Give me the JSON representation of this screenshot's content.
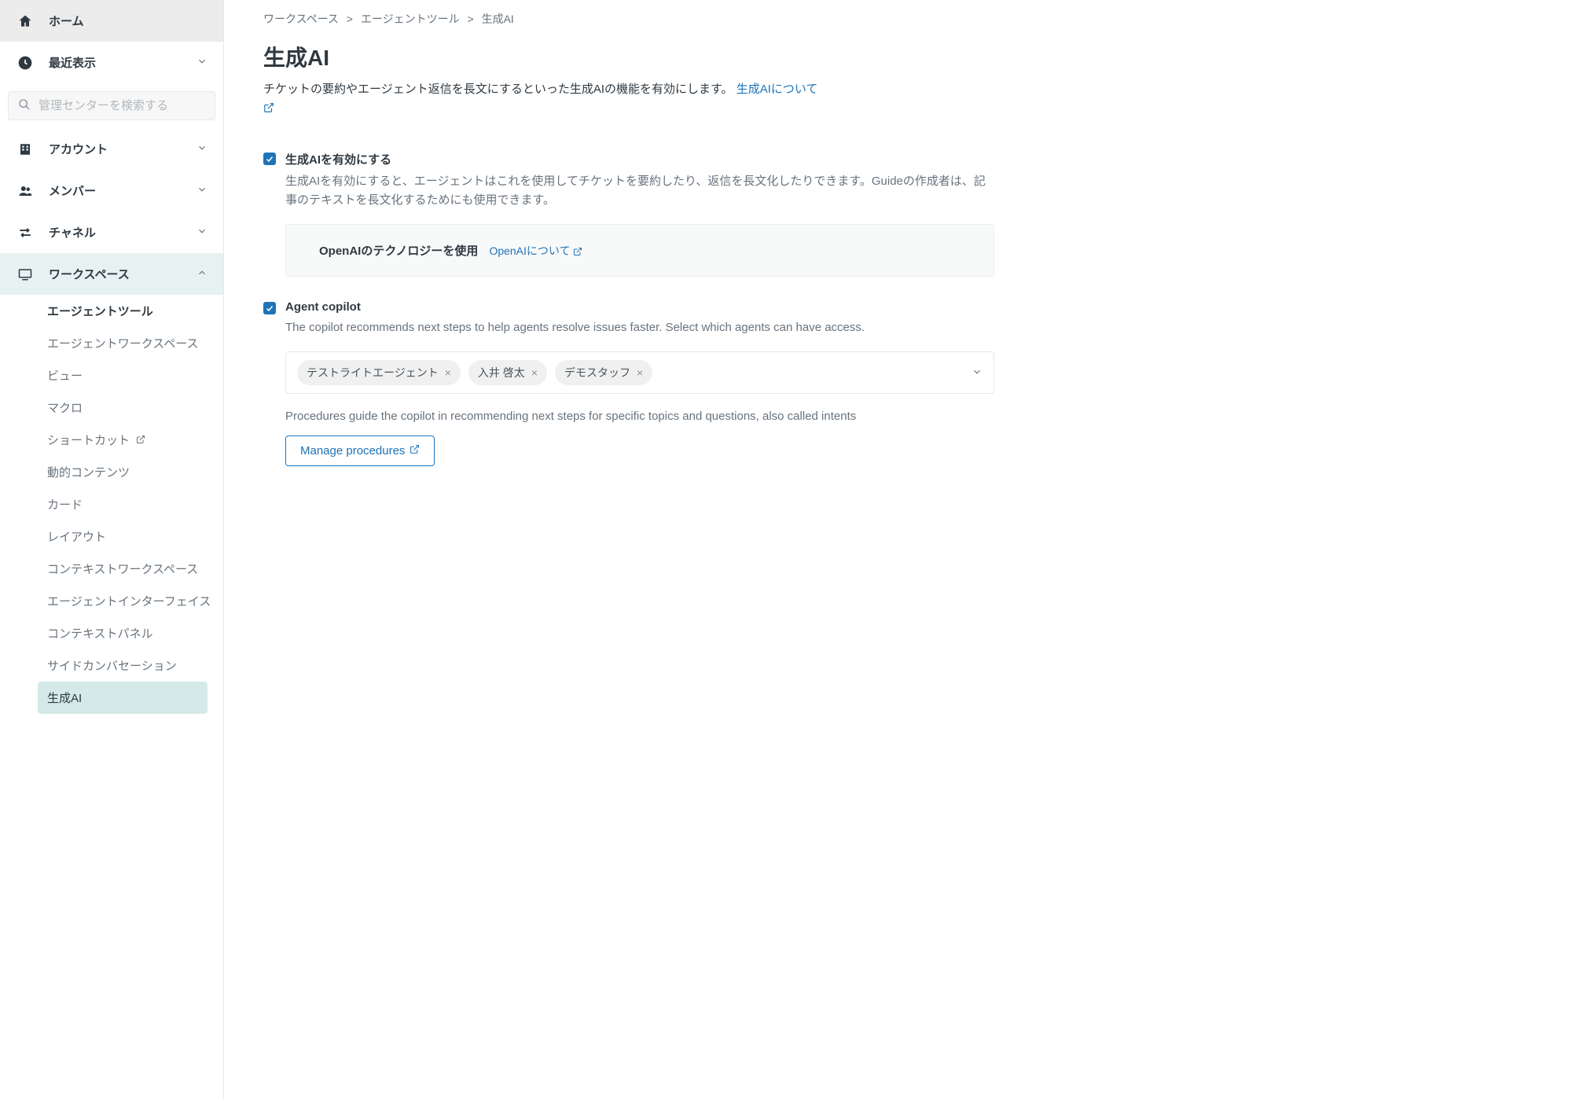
{
  "sidebar": {
    "home": "ホーム",
    "recent": "最近表示",
    "search_placeholder": "管理センターを検索する",
    "items": [
      {
        "label": "アカウント"
      },
      {
        "label": "メンバー"
      },
      {
        "label": "チャネル"
      },
      {
        "label": "ワークスペース"
      }
    ],
    "subnav": {
      "agent_tools": "エージェントツール",
      "items": [
        {
          "label": "エージェントワークスペース"
        },
        {
          "label": "ビュー"
        },
        {
          "label": "マクロ"
        },
        {
          "label": "ショートカット"
        },
        {
          "label": "動的コンテンツ"
        },
        {
          "label": "カード"
        },
        {
          "label": "レイアウト"
        },
        {
          "label": "コンテキストワークスペース"
        },
        {
          "label": "エージェントインターフェイス"
        },
        {
          "label": "コンテキストパネル"
        },
        {
          "label": "サイドカンバセーション"
        },
        {
          "label": "生成AI"
        }
      ]
    }
  },
  "breadcrumb": {
    "items": [
      "ワークスペース",
      "エージェントツール",
      "生成AI"
    ]
  },
  "page": {
    "title": "生成AI",
    "description": "チケットの要約やエージェント返信を長文にするといった生成AIの機能を有効にします。",
    "description_link": "生成AIについて"
  },
  "section1": {
    "title": "生成AIを有効にする",
    "description": "生成AIを有効にすると、エージェントはこれを使用してチケットを要約したり、返信を長文化したりできます。Guideの作成者は、記事のテキストを長文化するためにも使用できます。",
    "openai_title": "OpenAIのテクノロジーを使用",
    "openai_link": "OpenAIについて"
  },
  "section2": {
    "title": "Agent copilot",
    "description": "The copilot recommends next steps to help agents resolve issues faster. Select which agents can have access.",
    "chips": [
      {
        "label": "テストライトエージェント"
      },
      {
        "label": "入井 啓太"
      },
      {
        "label": "デモスタッフ"
      }
    ],
    "procedures_desc": "Procedures guide the copilot in recommending next steps for specific topics and questions, also called intents",
    "manage_btn": "Manage procedures"
  }
}
